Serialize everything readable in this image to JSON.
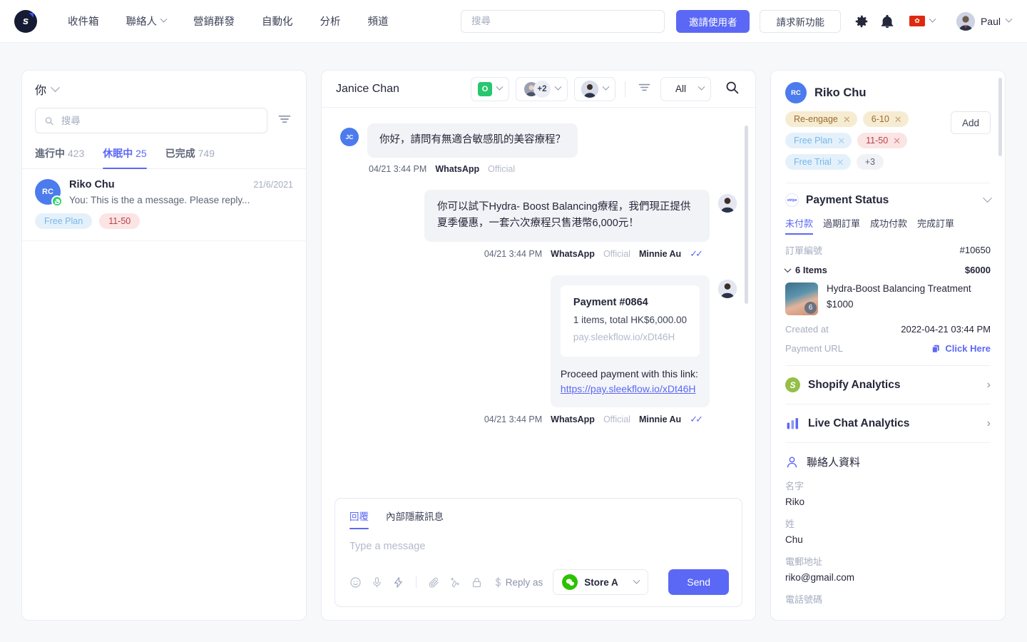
{
  "topnav": {
    "brand_letter": "s",
    "links": [
      {
        "label": "收件箱",
        "caret": false
      },
      {
        "label": "聯絡人",
        "caret": true
      },
      {
        "label": "營銷群發",
        "caret": false
      },
      {
        "label": "自動化",
        "caret": false
      },
      {
        "label": "分析",
        "caret": false
      },
      {
        "label": "頻道",
        "caret": false
      }
    ],
    "search_placeholder": "搜尋",
    "search_value": "",
    "invite_label": "邀請使用者",
    "request_label": "請求新功能",
    "gear_icon": "gear-icon",
    "bell_icon": "bell-icon",
    "flag_glyph": "✿",
    "user_name": "Paul"
  },
  "left": {
    "owner_label": "你",
    "search_placeholder": "搜尋",
    "search_value": "",
    "filter_icon": "filter-icon",
    "tabs": [
      {
        "label": "進行中",
        "count": "423",
        "active": false
      },
      {
        "label": "休眠中",
        "count": "25",
        "active": true
      },
      {
        "label": "已完成",
        "count": "749",
        "active": false
      }
    ],
    "conversations": [
      {
        "initials": "RC",
        "name": "Riko Chu",
        "date": "21/6/2021",
        "snippet": "You: This is the a message. Please reply...",
        "channel_icon": "whatsapp-icon",
        "chips": [
          {
            "label": "Free Plan",
            "style": "blue"
          },
          {
            "label": "11-50",
            "style": "pink"
          }
        ]
      }
    ]
  },
  "center": {
    "title": "Janice Chan",
    "channel_badge": "O",
    "assignee_extra": "+2",
    "filter_icon": "filter-icon",
    "all_label": "All",
    "search_icon": "search-icon",
    "messages": [
      {
        "direction": "in",
        "initials": "JC",
        "text": "你好，請問有無適合敏感肌的美容療程？",
        "time": "04/21 3:44 PM",
        "channel": "WhatsApp",
        "official": "Official",
        "agent": "",
        "ticks": false
      },
      {
        "direction": "out",
        "text": "你可以試下Hydra- Boost Balancing療程，我們現正提供夏季優惠，一套六次療程只售港幣6,000元！",
        "time": "04/21 3:44 PM",
        "channel": "WhatsApp",
        "official": "Official",
        "agent": "Minnie Au",
        "ticks": true
      }
    ],
    "payment_message": {
      "title": "Payment #0864",
      "subtitle": "1 items, total HK$6,000.00",
      "short_url": "pay.sleekflow.io/xDt46H",
      "footer_text": "Proceed payment with this link:",
      "link": "https://pay.sleekflow.io/xDt46H",
      "time": "04/21 3:44 PM",
      "channel": "WhatsApp",
      "official": "Official",
      "agent": "Minnie Au"
    },
    "composer": {
      "tabs": [
        {
          "label": "回覆",
          "active": true
        },
        {
          "label": "內部隱蔽訊息",
          "active": false
        }
      ],
      "placeholder": "Type a message",
      "value": "",
      "tools": [
        "emoji-icon",
        "mic-icon",
        "lightning-icon",
        "attachment-icon",
        "sparkle-icon",
        "lock-icon",
        "dollar-icon"
      ],
      "reply_as_label": "Reply as",
      "store_name": "Store A",
      "store_icon": "wechat-icon",
      "send_label": "Send"
    }
  },
  "right": {
    "initials": "RC",
    "name": "Riko Chu",
    "add_label": "Add",
    "tags": [
      {
        "label": "Re-engage",
        "style": "tan",
        "removable": true
      },
      {
        "label": "6-10",
        "style": "tan",
        "removable": true
      },
      {
        "label": "Free Plan",
        "style": "blue",
        "removable": true
      },
      {
        "label": "11-50",
        "style": "pink",
        "removable": true
      },
      {
        "label": "Free Trial",
        "style": "blue",
        "removable": true
      },
      {
        "label": "+3",
        "style": "grey",
        "removable": false
      }
    ],
    "payment": {
      "section_title": "Payment Status",
      "section_icon": "stripe-icon",
      "tabs": [
        {
          "label": "未付款",
          "active": true
        },
        {
          "label": "過期訂單",
          "active": false
        },
        {
          "label": "成功付款",
          "active": false
        },
        {
          "label": "完成訂單",
          "active": false
        }
      ],
      "order_label": "訂單編號",
      "order_number": "#10650",
      "items_label": "6 Items",
      "items_total": "$6000",
      "product_name": "Hydra-Boost Balancing Treatment",
      "product_price": "$1000",
      "product_qty": "6",
      "created_label": "Created at",
      "created_value": "2022-04-21 03:44 PM",
      "url_label": "Payment URL",
      "url_action": "Click Here"
    },
    "sections": [
      {
        "label": "Shopify Analytics",
        "icon": "shopify-icon"
      },
      {
        "label": "Live Chat Analytics",
        "icon": "bar-chart-icon"
      }
    ],
    "contact": {
      "title": "聯絡人資料",
      "icon": "person-icon",
      "fields": [
        {
          "label": "名字",
          "value": "Riko"
        },
        {
          "label": "姓",
          "value": "Chu"
        },
        {
          "label": "電郵地址",
          "value": "riko@gmail.com"
        },
        {
          "label": "電話號碼",
          "value": ""
        }
      ]
    }
  }
}
